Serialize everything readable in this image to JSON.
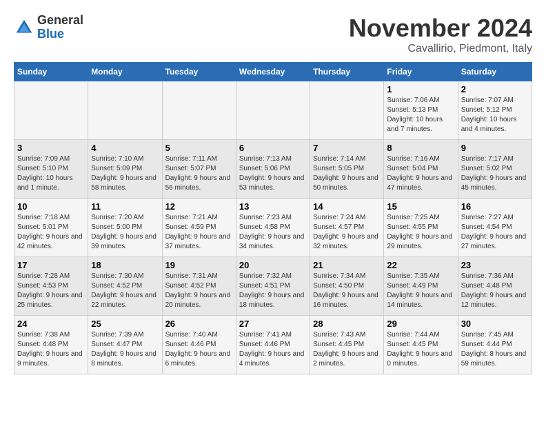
{
  "header": {
    "logo_general": "General",
    "logo_blue": "Blue",
    "month_title": "November 2024",
    "location": "Cavallirio, Piedmont, Italy"
  },
  "weekdays": [
    "Sunday",
    "Monday",
    "Tuesday",
    "Wednesday",
    "Thursday",
    "Friday",
    "Saturday"
  ],
  "weeks": [
    [
      {
        "day": "",
        "info": ""
      },
      {
        "day": "",
        "info": ""
      },
      {
        "day": "",
        "info": ""
      },
      {
        "day": "",
        "info": ""
      },
      {
        "day": "",
        "info": ""
      },
      {
        "day": "1",
        "info": "Sunrise: 7:06 AM\nSunset: 5:13 PM\nDaylight: 10 hours and 7 minutes."
      },
      {
        "day": "2",
        "info": "Sunrise: 7:07 AM\nSunset: 5:12 PM\nDaylight: 10 hours and 4 minutes."
      }
    ],
    [
      {
        "day": "3",
        "info": "Sunrise: 7:09 AM\nSunset: 5:10 PM\nDaylight: 10 hours and 1 minute."
      },
      {
        "day": "4",
        "info": "Sunrise: 7:10 AM\nSunset: 5:09 PM\nDaylight: 9 hours and 58 minutes."
      },
      {
        "day": "5",
        "info": "Sunrise: 7:11 AM\nSunset: 5:07 PM\nDaylight: 9 hours and 56 minutes."
      },
      {
        "day": "6",
        "info": "Sunrise: 7:13 AM\nSunset: 5:06 PM\nDaylight: 9 hours and 53 minutes."
      },
      {
        "day": "7",
        "info": "Sunrise: 7:14 AM\nSunset: 5:05 PM\nDaylight: 9 hours and 50 minutes."
      },
      {
        "day": "8",
        "info": "Sunrise: 7:16 AM\nSunset: 5:04 PM\nDaylight: 9 hours and 47 minutes."
      },
      {
        "day": "9",
        "info": "Sunrise: 7:17 AM\nSunset: 5:02 PM\nDaylight: 9 hours and 45 minutes."
      }
    ],
    [
      {
        "day": "10",
        "info": "Sunrise: 7:18 AM\nSunset: 5:01 PM\nDaylight: 9 hours and 42 minutes."
      },
      {
        "day": "11",
        "info": "Sunrise: 7:20 AM\nSunset: 5:00 PM\nDaylight: 9 hours and 39 minutes."
      },
      {
        "day": "12",
        "info": "Sunrise: 7:21 AM\nSunset: 4:59 PM\nDaylight: 9 hours and 37 minutes."
      },
      {
        "day": "13",
        "info": "Sunrise: 7:23 AM\nSunset: 4:58 PM\nDaylight: 9 hours and 34 minutes."
      },
      {
        "day": "14",
        "info": "Sunrise: 7:24 AM\nSunset: 4:57 PM\nDaylight: 9 hours and 32 minutes."
      },
      {
        "day": "15",
        "info": "Sunrise: 7:25 AM\nSunset: 4:55 PM\nDaylight: 9 hours and 29 minutes."
      },
      {
        "day": "16",
        "info": "Sunrise: 7:27 AM\nSunset: 4:54 PM\nDaylight: 9 hours and 27 minutes."
      }
    ],
    [
      {
        "day": "17",
        "info": "Sunrise: 7:28 AM\nSunset: 4:53 PM\nDaylight: 9 hours and 25 minutes."
      },
      {
        "day": "18",
        "info": "Sunrise: 7:30 AM\nSunset: 4:52 PM\nDaylight: 9 hours and 22 minutes."
      },
      {
        "day": "19",
        "info": "Sunrise: 7:31 AM\nSunset: 4:52 PM\nDaylight: 9 hours and 20 minutes."
      },
      {
        "day": "20",
        "info": "Sunrise: 7:32 AM\nSunset: 4:51 PM\nDaylight: 9 hours and 18 minutes."
      },
      {
        "day": "21",
        "info": "Sunrise: 7:34 AM\nSunset: 4:50 PM\nDaylight: 9 hours and 16 minutes."
      },
      {
        "day": "22",
        "info": "Sunrise: 7:35 AM\nSunset: 4:49 PM\nDaylight: 9 hours and 14 minutes."
      },
      {
        "day": "23",
        "info": "Sunrise: 7:36 AM\nSunset: 4:48 PM\nDaylight: 9 hours and 12 minutes."
      }
    ],
    [
      {
        "day": "24",
        "info": "Sunrise: 7:38 AM\nSunset: 4:48 PM\nDaylight: 9 hours and 9 minutes."
      },
      {
        "day": "25",
        "info": "Sunrise: 7:39 AM\nSunset: 4:47 PM\nDaylight: 9 hours and 8 minutes."
      },
      {
        "day": "26",
        "info": "Sunrise: 7:40 AM\nSunset: 4:46 PM\nDaylight: 9 hours and 6 minutes."
      },
      {
        "day": "27",
        "info": "Sunrise: 7:41 AM\nSunset: 4:46 PM\nDaylight: 9 hours and 4 minutes."
      },
      {
        "day": "28",
        "info": "Sunrise: 7:43 AM\nSunset: 4:45 PM\nDaylight: 9 hours and 2 minutes."
      },
      {
        "day": "29",
        "info": "Sunrise: 7:44 AM\nSunset: 4:45 PM\nDaylight: 9 hours and 0 minutes."
      },
      {
        "day": "30",
        "info": "Sunrise: 7:45 AM\nSunset: 4:44 PM\nDaylight: 8 hours and 59 minutes."
      }
    ]
  ]
}
